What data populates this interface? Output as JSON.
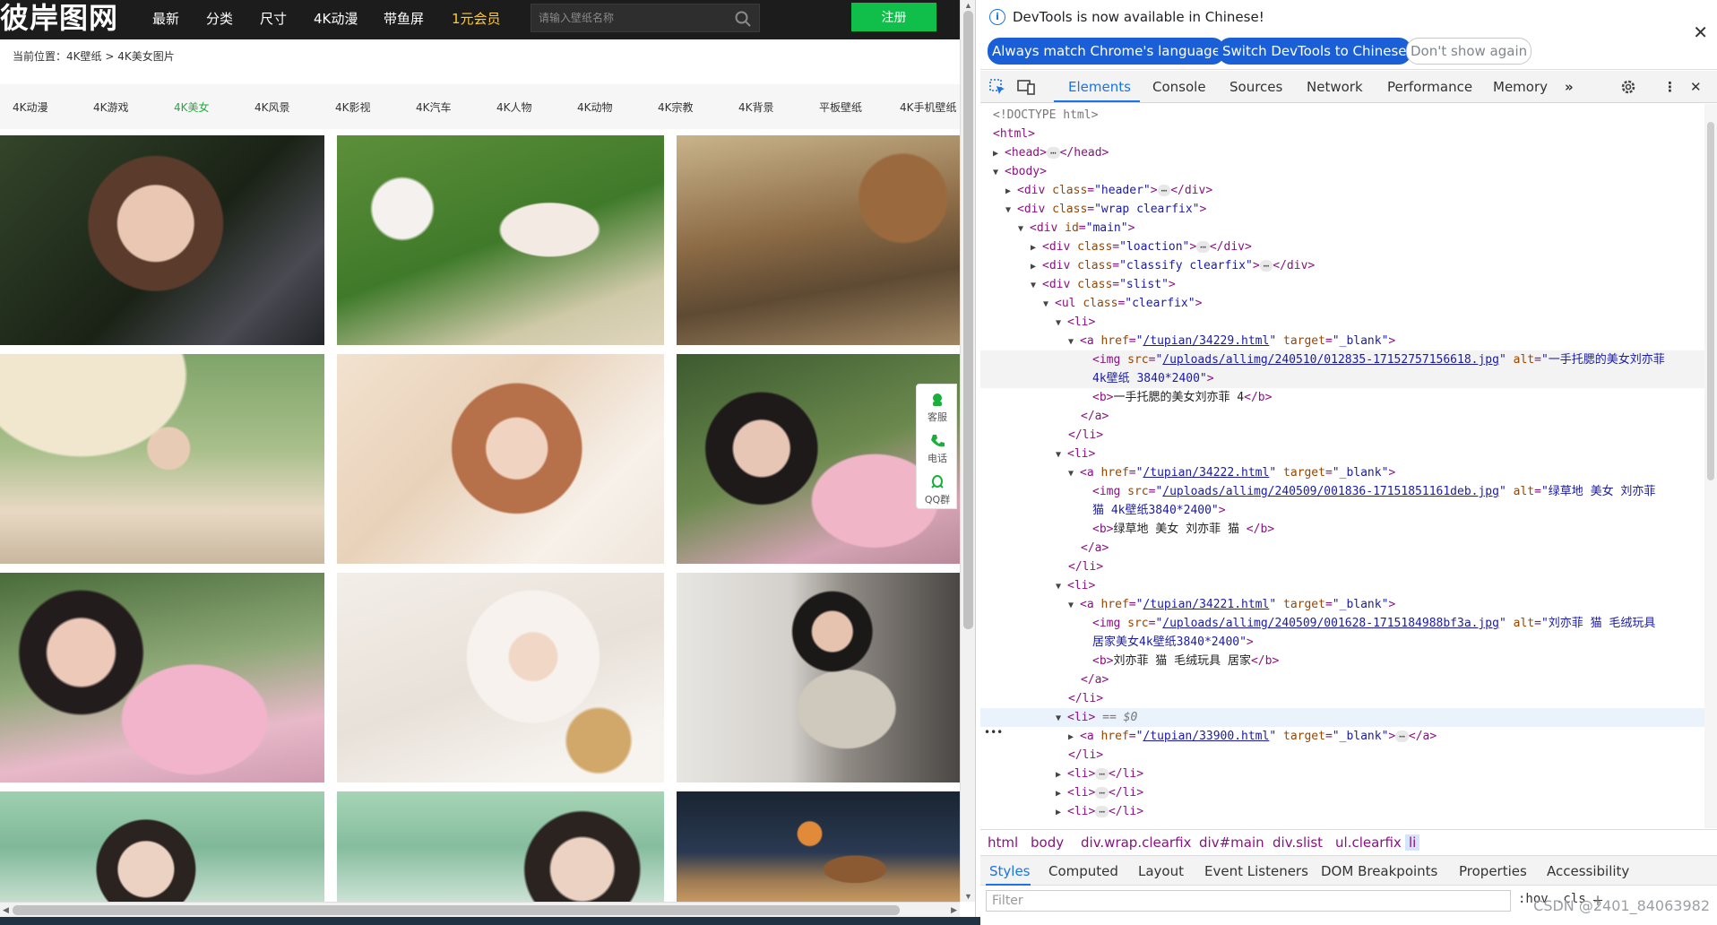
{
  "site": {
    "logo": "彼岸图网",
    "nav": [
      "最新",
      "分类",
      "尺寸",
      "4K动漫",
      "带鱼屏",
      "1元会员"
    ],
    "search_placeholder": "请输入壁纸名称",
    "register": "注册",
    "breadcrumb": "当前位置：4K壁纸 > 4K美女图片",
    "categories": [
      "4K动漫",
      "4K游戏",
      "4K美女",
      "4K风景",
      "4K影视",
      "4K汽车",
      "4K人物",
      "4K动物",
      "4K宗教",
      "4K背景",
      "平板壁纸",
      "4K手机壁纸"
    ],
    "active_category": "4K美女",
    "float_tools": [
      "客服",
      "电话",
      "QQ群"
    ],
    "colors": {
      "header_bg": "#1c1c1c",
      "register_bg": "#0fbf4a",
      "active_cat": "#1aaf3a",
      "vip": "#ffcc33"
    }
  },
  "devtools": {
    "info": {
      "message": "DevTools is now available in Chinese!",
      "btn_match": "Always match Chrome's language",
      "btn_switch": "Switch DevTools to Chinese",
      "btn_dismiss": "Don't show again"
    },
    "tabs": [
      "Elements",
      "Console",
      "Sources",
      "Network",
      "Performance",
      "Memory"
    ],
    "active_tab": "Elements",
    "dom": {
      "doctype": "<!DOCTYPE html>",
      "img1_src": "/uploads/allimg/240510/012835-17152757156618.jpg",
      "img1_alt": "一手托腮的美女刘亦菲",
      "img1_alt_cont": "4k壁纸 3840*2400",
      "img1_caption": "一手托腮的美女刘亦菲 4",
      "href1": "/tupian/34229.html",
      "href2": "/tupian/34222.html",
      "img2_src": "/uploads/allimg/240509/001836-17151851161deb.jpg",
      "img2_alt": "绿草地 美女 刘亦菲",
      "img2_alt_cont": "猫 4k壁纸3840*2400",
      "img2_caption": "绿草地 美女 刘亦菲 猫 ",
      "href3": "/tupian/34221.html",
      "img3_src": "/uploads/allimg/240509/001628-1715184988bf3a.jpg",
      "img3_alt": "刘亦菲 猫 毛绒玩具",
      "img3_alt_cont": "居家美女4k壁纸3840*2400",
      "img3_caption": "刘亦菲 猫 毛绒玩具 居家",
      "href4": "/tupian/33900.html",
      "selected_marker": "== $0"
    },
    "breadcrumbs": [
      "html",
      "body",
      "div.wrap.clearfix",
      "div#main",
      "div.slist",
      "ul.clearfix",
      "li"
    ],
    "subtabs": [
      "Styles",
      "Computed",
      "Layout",
      "Event Listeners",
      "DOM Breakpoints",
      "Properties",
      "Accessibility"
    ],
    "filter_placeholder": "Filter",
    "filter_hov": ":hov",
    "filter_cls": ".cls",
    "watermark": "CSDN @2401_84063982"
  }
}
